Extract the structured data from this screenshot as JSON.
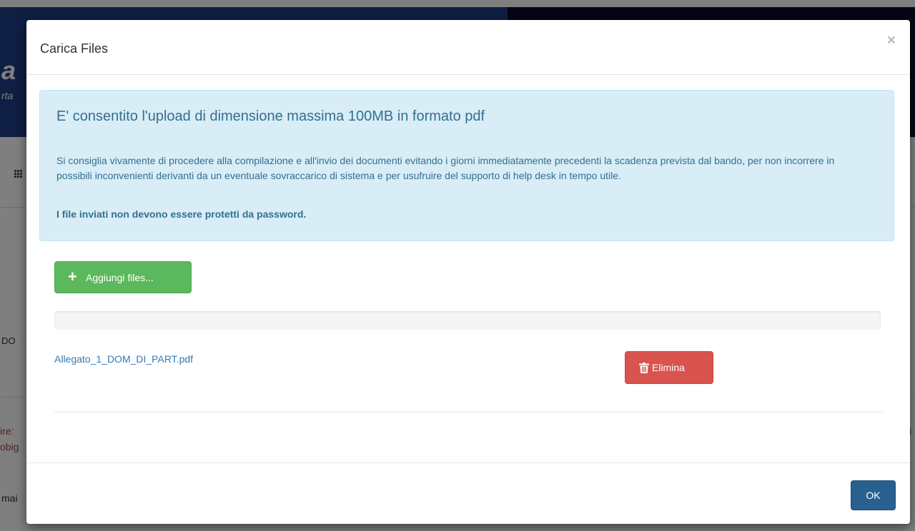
{
  "background": {
    "logo_text": "a",
    "logo_subtext": "rta",
    "text_1": "DO",
    "text_2": "ire:",
    "text_3": "obig",
    "text_4": "mai",
    "text_right": "i"
  },
  "modal": {
    "title": "Carica Files",
    "close_label": "×"
  },
  "info": {
    "title": "E' consentito l'upload di dimensione massima 100MB in formato pdf",
    "text": "Si consiglia vivamente di procedere alla compilazione e all'invio dei documenti evitando i giorni immediatamente precedenti la scadenza prevista dal bando, per non incorrere in possibili inconvenienti derivanti da un eventuale sovraccarico di sistema e per usufruire del supporto di help desk in tempo utile.",
    "bold_text": "I file inviati non devono essere protetti da password."
  },
  "upload": {
    "add_button_label": "Aggiungi files...",
    "add_button_icon": "plus-icon",
    "progress_percent": 0
  },
  "files": [
    {
      "name": "Allegato_1_DOM_DI_PART.pdf",
      "delete_label": "Elimina",
      "delete_icon": "trash-icon"
    }
  ],
  "footer": {
    "ok_label": "OK"
  },
  "colors": {
    "info_bg": "#d9edf7",
    "info_text": "#31708f",
    "success": "#5cb85c",
    "danger": "#d9534f",
    "primary": "#286090",
    "link": "#337ab7"
  }
}
